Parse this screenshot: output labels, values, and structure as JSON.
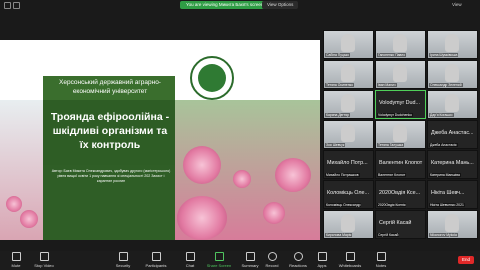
{
  "topbar": {
    "banner": "You are viewing Микита Баєв's screen",
    "view_options": "View Options",
    "view": "View"
  },
  "slide": {
    "university": "Херсонський державний аграрно-економічний університет",
    "title": "Троянда ефіроолійна - шкідливі організми та їх контроль",
    "author": "Автор: Баєв Микита Олександрович, здобувач другого (магістерського) рівня вищої освіти 1 року навчання зі спеціальності 202 Захист і карантин рослин"
  },
  "gallery": [
    {
      "name": "",
      "label": "Сабіна Пуцько",
      "video": true
    },
    {
      "name": "",
      "label": "Гапоненко Павло",
      "video": true
    },
    {
      "name": "",
      "label": "Ірина Шумківська",
      "video": true
    },
    {
      "name": "",
      "label": "Тетяна Осипенко",
      "video": true
    },
    {
      "name": "",
      "label": "Іван Манич",
      "video": true
    },
    {
      "name": "",
      "label": "Олександр Зелений",
      "video": true
    },
    {
      "name": "",
      "label": "Карина Дегтяр",
      "video": true
    },
    {
      "name": "Volodymyr Dud...",
      "label": "Volodymyr Dudchenko",
      "video": false
    },
    {
      "name": "",
      "label": "Дар'я Когашко",
      "video": true
    },
    {
      "name": "",
      "label": "Зоя Шевчук",
      "video": true
    },
    {
      "name": "",
      "label": "Тетяна Галушка",
      "video": true
    },
    {
      "name": "Джеба Анастас...",
      "label": "Джеба Анастасія",
      "video": false
    },
    {
      "name": "Михайло Потр...",
      "label": "Михайло Потрашков",
      "video": false
    },
    {
      "name": "Валентин Клопот",
      "label": "Валентин Клопот",
      "video": false
    },
    {
      "name": "Катерина Мань...",
      "label": "Катерина Маньківа",
      "video": false
    },
    {
      "name": "Коломієць Оле...",
      "label": "Коломієць Олександр",
      "video": false
    },
    {
      "name": "2020Овдія Ксе...",
      "label": "2020Овдія Ксенія",
      "video": false
    },
    {
      "name": "Нікіта Шевч...",
      "label": "Нікіта Шевченко 2021",
      "video": false
    },
    {
      "name": "",
      "label": "Кирилова Марія",
      "video": true
    },
    {
      "name": "Сергій Касай",
      "label": "Сергій Касай",
      "video": false
    },
    {
      "name": "",
      "label": "Nikanorov Mykola",
      "video": true
    }
  ],
  "toolbar": {
    "mute": "Mute",
    "stop_video": "Stop Video",
    "security": "Security",
    "participants": "Participants",
    "participants_count": "45",
    "chat": "Chat",
    "share_screen": "Share Screen",
    "summary": "Summary",
    "record": "Record",
    "reactions": "Reactions",
    "apps": "Apps",
    "whiteboards": "Whiteboards",
    "notes": "Notes",
    "end": "End"
  }
}
